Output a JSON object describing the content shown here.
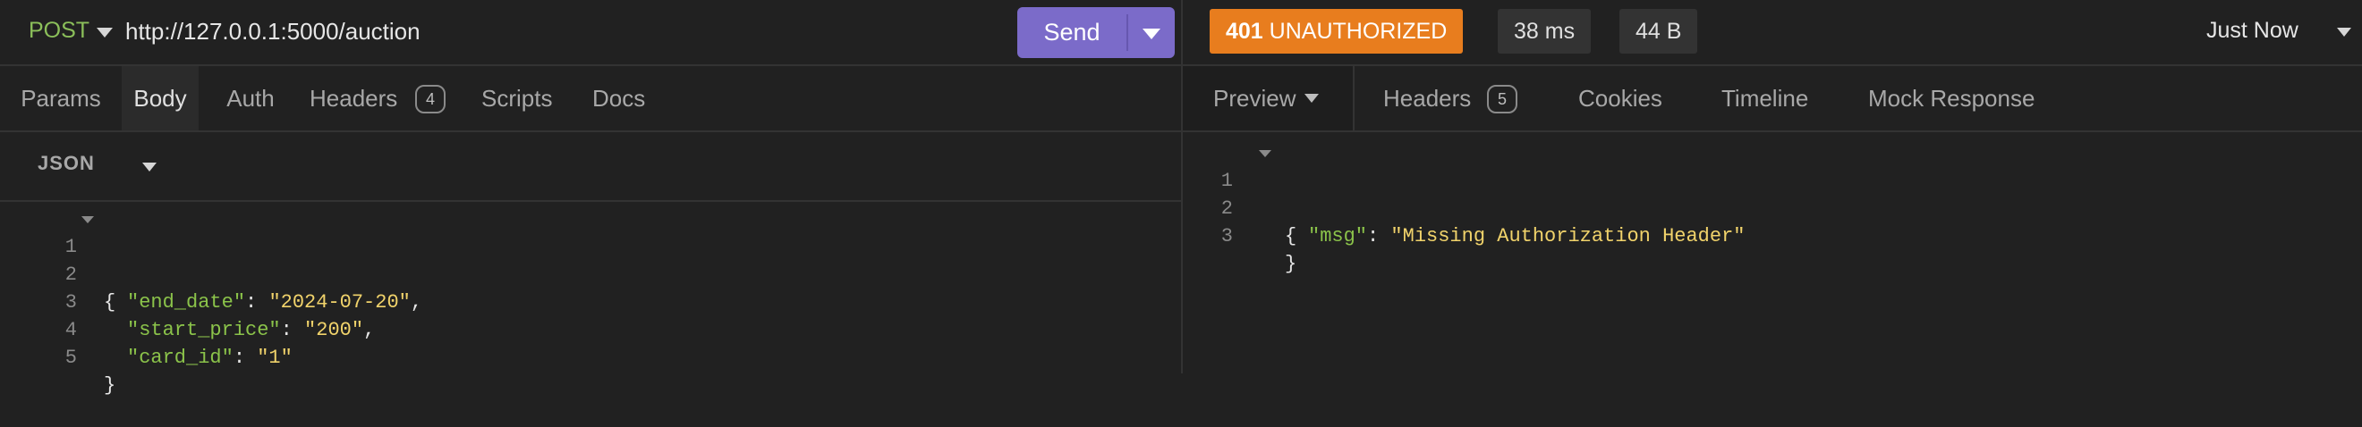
{
  "request": {
    "method": "POST",
    "url": "http://127.0.0.1:5000/auction",
    "send_label": "Send",
    "tabs": [
      {
        "label": "Params",
        "active": false
      },
      {
        "label": "Body",
        "active": true
      },
      {
        "label": "Auth",
        "active": false
      },
      {
        "label": "Headers",
        "active": false,
        "badge": "4"
      },
      {
        "label": "Scripts",
        "active": false
      },
      {
        "label": "Docs",
        "active": false
      }
    ],
    "body_type": "JSON",
    "body_lines": [
      {
        "n": "1",
        "text": "{"
      },
      {
        "n": "2",
        "key": "\"end_date\"",
        "value": "\"2024-07-20\""
      },
      {
        "n": "3",
        "key": "\"start_price\"",
        "value": "\"200\""
      },
      {
        "n": "4",
        "key": "\"card_id\"",
        "value": "\"1\""
      },
      {
        "n": "5",
        "text": "}"
      }
    ]
  },
  "response": {
    "status_code": "401",
    "status_text": "UNAUTHORIZED",
    "time": "38 ms",
    "size": "44 B",
    "timestamp": "Just Now",
    "tabs": [
      {
        "label": "Preview",
        "active": true
      },
      {
        "label": "Headers",
        "badge": "5"
      },
      {
        "label": "Cookies"
      },
      {
        "label": "Timeline"
      },
      {
        "label": "Mock Response"
      }
    ],
    "body_lines": [
      {
        "n": "1",
        "text": "{"
      },
      {
        "n": "2",
        "key": "\"msg\"",
        "value": "\"Missing Authorization Header\""
      },
      {
        "n": "3",
        "text": "}"
      }
    ]
  },
  "colors": {
    "accent": "#7b6bc9",
    "status_error": "#e87d1e",
    "json_key": "#8bc34a",
    "json_string": "#f1d36b"
  }
}
